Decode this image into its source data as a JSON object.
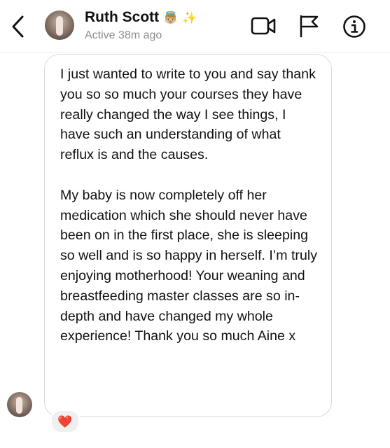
{
  "header": {
    "contact_name": "Ruth Scott",
    "name_emojis": [
      "👼🏼",
      "✨"
    ],
    "status": "Active 38m ago"
  },
  "icons": {
    "back": "chevron-left-icon",
    "video": "video-camera-icon",
    "flag": "flag-icon",
    "info": "info-icon"
  },
  "message": {
    "paragraphs": [
      "I just wanted to write to you and say thank you so so much your courses they have really changed the way I see things, I have such an understanding of what reflux is and the causes.",
      "My baby is now completely off her medication which she should never have been on in the first place, she is sleeping so well and is so happy in herself. I’m truly enjoying motherhood! Your weaning and breastfeeding master classes are so in-depth and have changed my whole experience! Thank you so much Aine x"
    ],
    "reaction": "❤️"
  }
}
